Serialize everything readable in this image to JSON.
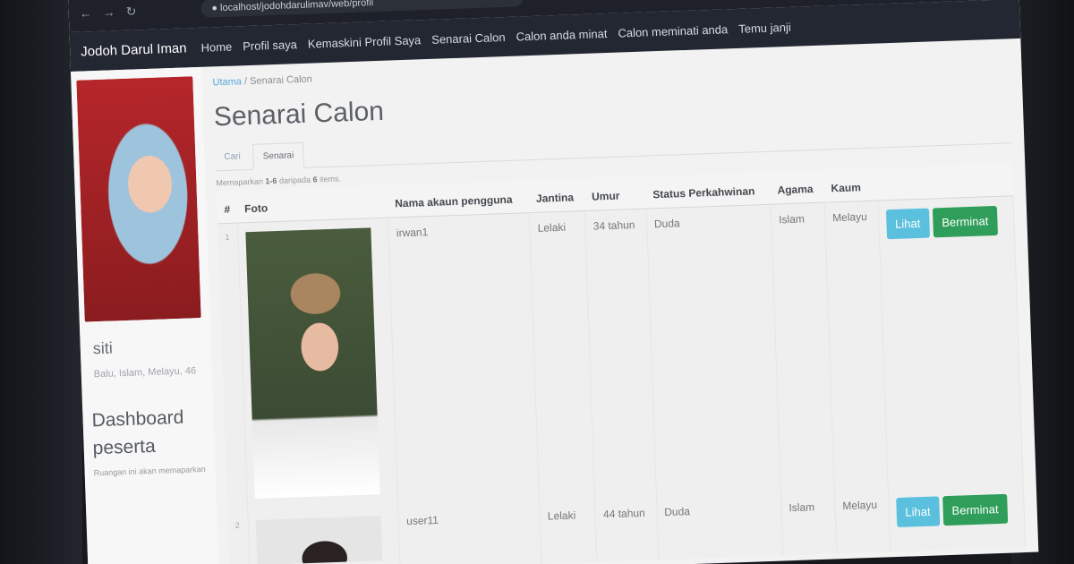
{
  "browser": {
    "url": "localhost/jodohdarulimav/web/profil"
  },
  "navbar": {
    "brand": "Jodoh Darul Iman",
    "links": [
      "Home",
      "Profil saya",
      "Kemaskini Profil Saya",
      "Senarai Calon",
      "Calon anda minat",
      "Calon meminati anda",
      "Temu janji"
    ]
  },
  "sidebar": {
    "name": "siti",
    "description": "Balu, Islam, Melayu, 46",
    "heading_line1": "Dashboard",
    "heading_line2": "peserta",
    "subtext": "Ruangan ini akan memaparkan"
  },
  "page": {
    "breadcrumb_home": "Utama",
    "breadcrumb_sep": "/",
    "breadcrumb_current": "Senarai Calon",
    "title": "Senarai Calon",
    "tabs": [
      "Cari",
      "Senarai"
    ],
    "summary_prefix": "Memaparkan",
    "summary_range": "1-6",
    "summary_mid": "daripada",
    "summary_total": "6",
    "summary_suffix": "items."
  },
  "table": {
    "headers": [
      "#",
      "Foto",
      "Nama akaun pengguna",
      "Jantina",
      "Umur",
      "Status Perkahwinan",
      "Agama",
      "Kaum",
      ""
    ],
    "rows": [
      {
        "num": "1",
        "username": "irwan1",
        "gender": "Lelaki",
        "age": "34 tahun",
        "status": "Duda",
        "religion": "Islam",
        "race": "Melayu"
      },
      {
        "num": "2",
        "username": "user11",
        "gender": "Lelaki",
        "age": "44 tahun",
        "status": "Duda",
        "religion": "Islam",
        "race": "Melayu"
      }
    ],
    "view_label": "Lihat",
    "interest_label": "Berminat"
  }
}
